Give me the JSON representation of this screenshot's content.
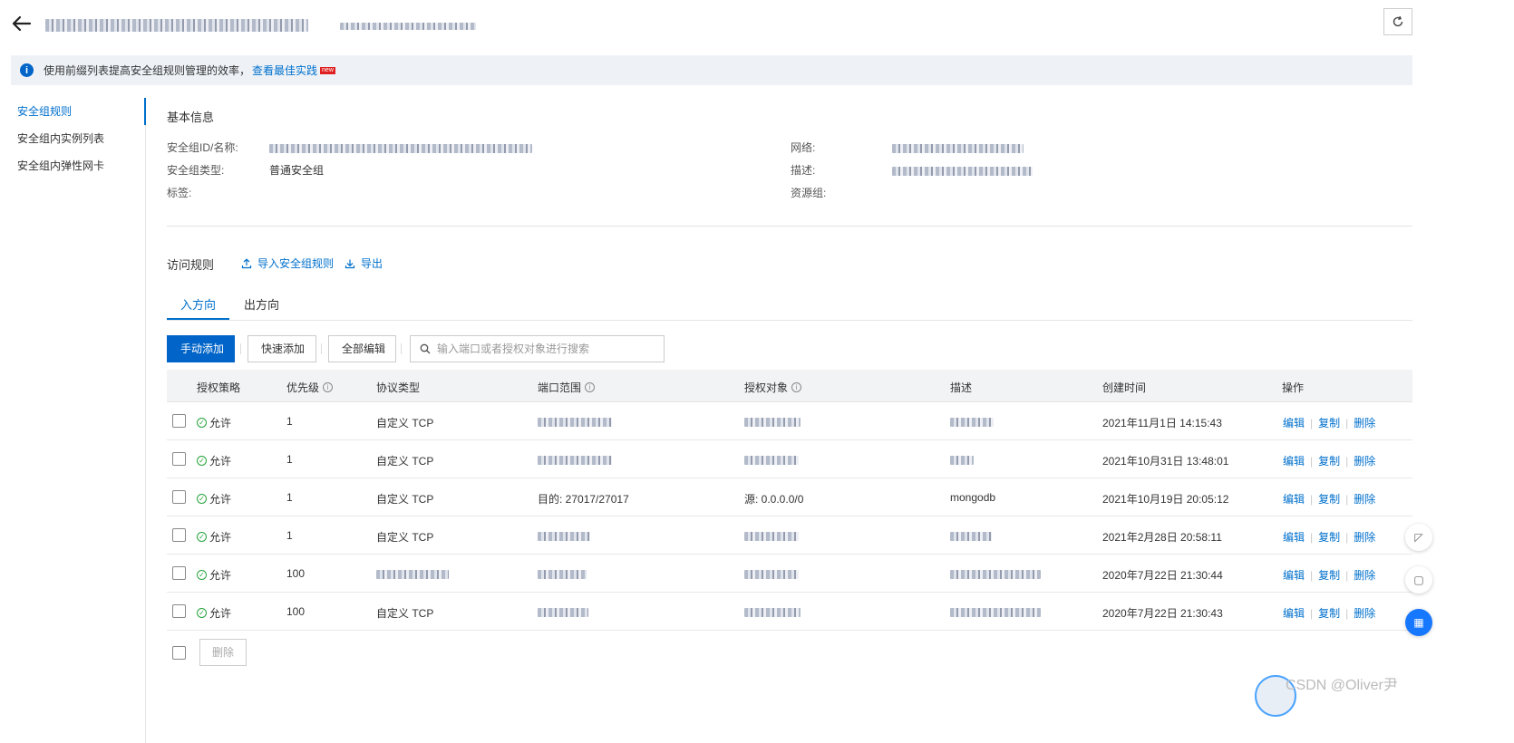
{
  "header": {
    "title": "sg-bp1fzjk...",
    "subtitle": "...",
    "refresh_icon": "refresh-icon",
    "back_icon": "arrow-left-icon"
  },
  "notice": {
    "text": "使用前缀列表提高安全组规则管理的效率，",
    "link": "查看最佳实践",
    "badge": "new"
  },
  "sidenav": {
    "items": [
      {
        "label": "安全组规则"
      },
      {
        "label": "安全组内实例列表"
      },
      {
        "label": "安全组内弹性网卡"
      }
    ]
  },
  "basic_info": {
    "title": "基本信息",
    "left": [
      {
        "label": "安全组ID/名称:",
        "value": ""
      },
      {
        "label": "安全组类型:",
        "value": "普通安全组"
      },
      {
        "label": "标签:",
        "value": ""
      }
    ],
    "right": [
      {
        "label": "网络:",
        "value": ""
      },
      {
        "label": "描述:",
        "value": ""
      },
      {
        "label": "资源组:",
        "value": ""
      }
    ]
  },
  "rules": {
    "title": "访问规则",
    "import_label": "导入安全组规则",
    "export_label": "导出",
    "tabs": [
      {
        "label": "入方向"
      },
      {
        "label": "出方向"
      }
    ],
    "toolbar": {
      "manual_add": "手动添加",
      "quick_add": "快速添加",
      "edit_all": "全部编辑",
      "search_placeholder": "输入端口或者授权对象进行搜索"
    },
    "columns": [
      "授权策略",
      "优先级",
      "协议类型",
      "端口范围",
      "授权对象",
      "描述",
      "创建时间",
      "操作"
    ],
    "rows": [
      {
        "policy": "允许",
        "priority": "1",
        "protocol": "自定义 TCP",
        "port": "",
        "source": "",
        "desc": "",
        "created": "2021年11月1日 14:15:43"
      },
      {
        "policy": "允许",
        "priority": "1",
        "protocol": "自定义 TCP",
        "port": "",
        "source": "",
        "desc": "",
        "created": "2021年10月31日 13:48:01"
      },
      {
        "policy": "允许",
        "priority": "1",
        "protocol": "自定义 TCP",
        "port": "目的: 27017/27017",
        "source": "源: 0.0.0.0/0",
        "desc": "mongodb",
        "created": "2021年10月19日 20:05:12"
      },
      {
        "policy": "允许",
        "priority": "1",
        "protocol": "自定义 TCP",
        "port": "",
        "source": "",
        "desc": "",
        "created": "2021年2月28日 20:58:11"
      },
      {
        "policy": "允许",
        "priority": "100",
        "protocol": "",
        "port": "",
        "source": "",
        "desc": "",
        "created": "2020年7月22日 21:30:44"
      },
      {
        "policy": "允许",
        "priority": "100",
        "protocol": "自定义 TCP",
        "port": "",
        "source": "",
        "desc": "",
        "created": "2020年7月22日 21:30:43"
      }
    ],
    "actions": {
      "edit": "编辑",
      "copy": "复制",
      "delete": "删除"
    },
    "footer_delete": "删除"
  },
  "watermark": "CSDN @Oliver尹"
}
